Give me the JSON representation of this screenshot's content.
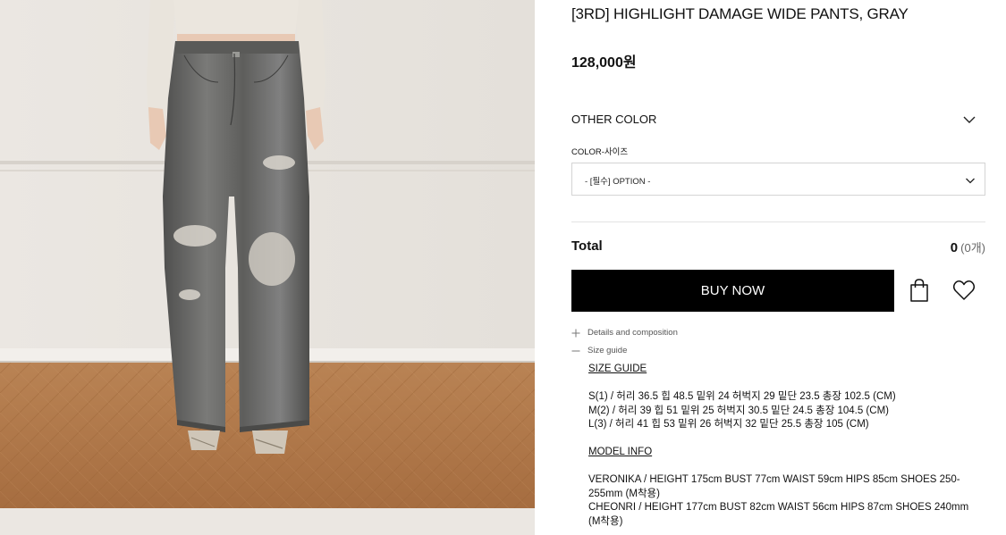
{
  "product": {
    "title": "[3RD] HIGHLIGHT DAMAGE WIDE PANTS, GRAY",
    "price": "128,000원"
  },
  "options": {
    "other_color_label": "OTHER COLOR",
    "select_label": "COLOR-사이즈",
    "select_value": "- [필수] OPTION -"
  },
  "total": {
    "label": "Total",
    "amount": "0",
    "count": "(0개)"
  },
  "actions": {
    "buy_label": "BUY NOW",
    "cart_icon": "shopping-bag-icon",
    "wish_icon": "heart-icon"
  },
  "accordion": {
    "details_label": "Details and composition",
    "size_label": "Size guide"
  },
  "size_guide": {
    "heading": "SIZE GUIDE",
    "rows": [
      "S(1) / 허리 36.5 힙 48.5 밑위 24 허벅지 29 밑단 23.5 총장 102.5 (CM)",
      "M(2) / 허리 39 힙 51 밑위 25 허벅지 30.5 밑단 24.5 총장 104.5 (CM)",
      "L(3) / 허리 41 힙 53 밑위 26 허벅지 32 밑단 25.5 총장 105 (CM)"
    ],
    "model_heading": "MODEL INFO",
    "models": [
      "VERONIKA / HEIGHT 175cm BUST 77cm WAIST 59cm HIPS 85cm SHOES 250-255mm (M착용)",
      "CHEONRI / HEIGHT 177cm BUST 82cm WAIST 56cm HIPS 87cm SHOES 240mm (M착용)"
    ]
  },
  "colors": {
    "button_bg": "#000000",
    "wall": "#e9e5e0",
    "floor": "#b57c4e",
    "denim": "#6b6b69"
  }
}
